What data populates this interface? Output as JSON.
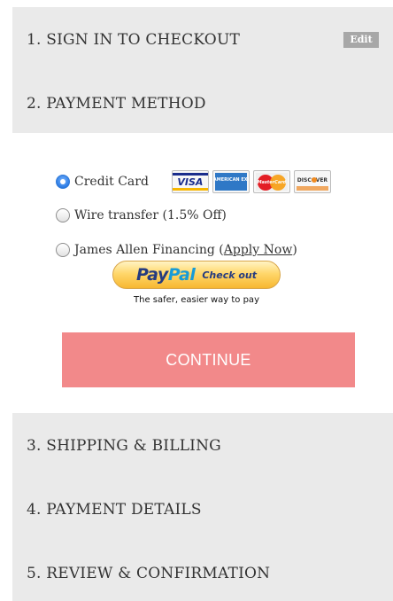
{
  "steps": [
    {
      "label": "1. SIGN IN TO CHECKOUT",
      "action_label": "Edit"
    },
    {
      "label": "2. PAYMENT METHOD"
    },
    {
      "label": "3. SHIPPING & BILLING"
    },
    {
      "label": "4. PAYMENT DETAILS"
    },
    {
      "label": "5. REVIEW & CONFIRMATION"
    }
  ],
  "payment_options": [
    {
      "label": "Credit Card",
      "selected": true
    },
    {
      "label": "Wire transfer (1.5% Off)",
      "selected": false
    },
    {
      "label_prefix": "James Allen Financing (",
      "link_label": "Apply Now",
      "label_suffix": ")",
      "selected": false
    }
  ],
  "card_logos": [
    {
      "name": "visa-logo",
      "text": "VISA"
    },
    {
      "name": "american-express-logo",
      "text": "AMERICAN EXPRESS"
    },
    {
      "name": "mastercard-logo",
      "text": "MasterCard"
    },
    {
      "name": "discover-logo",
      "text": "DISCOVER"
    }
  ],
  "paypal": {
    "logo_pay": "Pay",
    "logo_pal": "Pal",
    "button_label": "Check out",
    "tagline": "The safer, easier way to pay"
  },
  "continue_label": "CONTINUE",
  "colors": {
    "panel_bg": "#eaeaea",
    "continue_bg": "#f2898a",
    "edit_bg": "#a7a7a7",
    "radio_selected": "#2b7be4"
  }
}
